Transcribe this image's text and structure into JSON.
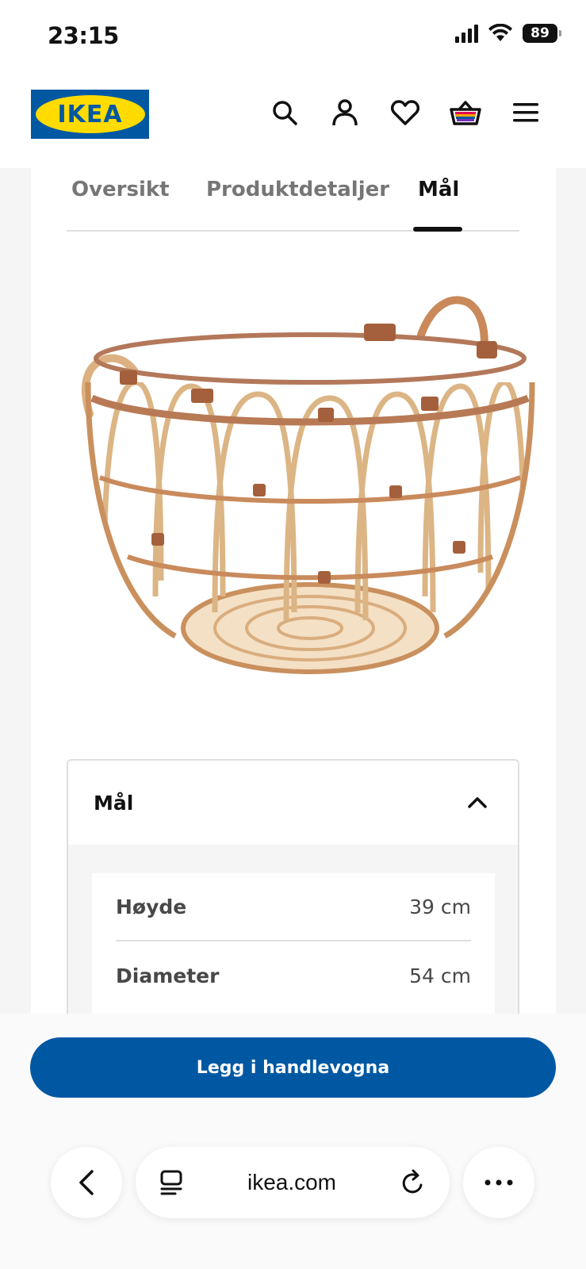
{
  "status_bar": {
    "time": "23:15",
    "battery": "89"
  },
  "header": {
    "logo_text": "IKEA",
    "icons": [
      "search-icon",
      "account-icon",
      "heart-icon",
      "basket-icon",
      "menu-icon"
    ]
  },
  "tabs": [
    {
      "label": "Oversikt",
      "active": false
    },
    {
      "label": "Produktdetaljer",
      "active": false
    },
    {
      "label": "Mål",
      "active": true
    }
  ],
  "product": {
    "image": "rattan-basket-image"
  },
  "dimensions": {
    "title": "Mål",
    "rows": [
      {
        "label": "Høyde",
        "value": "39 cm"
      },
      {
        "label": "Diameter",
        "value": "54 cm"
      }
    ]
  },
  "cta": {
    "label": "Legg i handlevogna"
  },
  "browser": {
    "url": "ikea.com"
  },
  "colors": {
    "brand_blue": "#0058a3",
    "brand_yellow": "#ffdb00"
  }
}
